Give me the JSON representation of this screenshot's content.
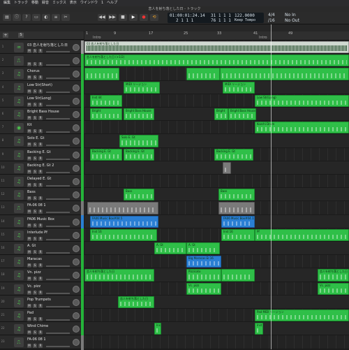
{
  "menubar": {
    "items": [
      "編集",
      "トラック",
      "移動",
      "録音",
      "ミックス",
      "表示",
      "ウインドウ",
      "1",
      "ヘルプ"
    ]
  },
  "window": {
    "title": "恋人を射ち落とした日 - トラック"
  },
  "lcd": {
    "position": "01:00:01:24.14",
    "position_sub": "2  1  1   1",
    "bars": "31  1  1   1",
    "bars_sub": "76  1  1   1",
    "tempo": "122.0000",
    "tempo_mode": "Keep Tempo",
    "signature": "4/4",
    "division": "/16",
    "in": "No In",
    "out": "No Out"
  },
  "ruler": {
    "ticks": [
      "1",
      "9",
      "17",
      "25",
      "33",
      "41",
      "49"
    ],
    "markers": [
      "Intro",
      "Intro"
    ]
  },
  "tracks": [
    {
      "num": "1",
      "name": "03 恋人を射ち落とした日",
      "icon": "audio-icon",
      "color": "#9a9a9a"
    },
    {
      "num": "2",
      "name": "",
      "icon": "midi-icon",
      "color": "#25b43a"
    },
    {
      "num": "3",
      "name": "Chorus",
      "icon": "synth-icon",
      "color": "#25b43a"
    },
    {
      "num": "4",
      "name": "Low Str(Short)",
      "icon": "synth-icon",
      "color": "#25b43a"
    },
    {
      "num": "5",
      "name": "Low Str(Long)",
      "icon": "synth-icon",
      "color": "#25b43a"
    },
    {
      "num": "6",
      "name": "Bright Bass House",
      "icon": "synth-icon",
      "color": "#25b43a"
    },
    {
      "num": "7",
      "name": "Kit",
      "icon": "drum-icon",
      "color": "#25b43a"
    },
    {
      "num": "8",
      "name": "Solo E. Gt",
      "icon": "synth-icon",
      "color": "#25b43a"
    },
    {
      "num": "9",
      "name": "Backing E. Gt",
      "icon": "synth-icon",
      "color": "#25b43a"
    },
    {
      "num": "10",
      "name": "Backing E. Gt 2",
      "icon": "synth-icon",
      "color": "#25b43a"
    },
    {
      "num": "11",
      "name": "Delayed E. Gt",
      "icon": "synth-icon",
      "color": "#25b43a"
    },
    {
      "num": "12",
      "name": "Bass",
      "icon": "synth-icon",
      "color": "#25b43a"
    },
    {
      "num": "13",
      "name": "FA-06 08 1",
      "icon": "midi-icon",
      "color": "#7a7a7a"
    },
    {
      "num": "14",
      "name": "FA06 Music Box",
      "icon": "synth-icon",
      "color": "#2a7fd4"
    },
    {
      "num": "15",
      "name": "Interlude Pf",
      "icon": "synth-icon",
      "color": "#25b43a"
    },
    {
      "num": "16",
      "name": "A. Gt",
      "icon": "synth-icon",
      "color": "#25b43a"
    },
    {
      "num": "17",
      "name": "Maracas",
      "icon": "synth-icon",
      "color": "#25b43a"
    },
    {
      "num": "18",
      "name": "Vn. pizz",
      "icon": "synth-icon",
      "color": "#25b43a"
    },
    {
      "num": "19",
      "name": "Vc. pizz",
      "icon": "synth-icon",
      "color": "#25b43a"
    },
    {
      "num": "20",
      "name": "Pop Trumpets",
      "icon": "synth-icon",
      "color": "#25b43a"
    },
    {
      "num": "21",
      "name": "Pad",
      "icon": "synth-icon",
      "color": "#25b43a"
    },
    {
      "num": "22",
      "name": "Wind Chime",
      "icon": "synth-icon",
      "color": "#25b43a"
    },
    {
      "num": "23",
      "name": "FA-06 08 1",
      "icon": "midi-icon",
      "color": "#7a7a7a"
    }
  ],
  "regions": [
    {
      "track": 0,
      "start": 0,
      "len": 379,
      "label": "03 恋人を射ち落とした日",
      "kind": "white"
    },
    {
      "track": 1,
      "start": 0,
      "len": 379,
      "label": "恋人を射ち落とした日 (+1/2)",
      "kind": "green"
    },
    {
      "track": 2,
      "start": 0,
      "len": 50,
      "label": "",
      "kind": "green"
    },
    {
      "track": 2,
      "start": 146,
      "len": 48,
      "label": "",
      "kind": "green"
    },
    {
      "track": 2,
      "start": 194,
      "len": 185,
      "label": "",
      "kind": "green"
    },
    {
      "track": 3,
      "start": 56,
      "len": 52,
      "label": "MIDI リージョン",
      "kind": "green"
    },
    {
      "track": 3,
      "start": 198,
      "len": 46,
      "label": "MIDI リージョン",
      "kind": "green"
    },
    {
      "track": 4,
      "start": 8,
      "len": 46,
      "label": "Inst 44",
      "kind": "green"
    },
    {
      "track": 4,
      "start": 244,
      "len": 135,
      "label": "Low Str(Long)",
      "kind": "green"
    },
    {
      "track": 5,
      "start": 8,
      "len": 46,
      "label": "Bright",
      "kind": "green"
    },
    {
      "track": 5,
      "start": 56,
      "len": 44,
      "label": "Bright Bass House",
      "kind": "green"
    },
    {
      "track": 5,
      "start": 186,
      "len": 20,
      "label": "Bright",
      "kind": "green"
    },
    {
      "track": 5,
      "start": 206,
      "len": 40,
      "label": "Bright Bass House",
      "kind": "green"
    },
    {
      "track": 6,
      "start": 244,
      "len": 135,
      "label": "Kozchi Drum",
      "kind": "green"
    },
    {
      "track": 7,
      "start": 50,
      "len": 56,
      "label": "Solo E. Gt",
      "kind": "green"
    },
    {
      "track": 8,
      "start": 8,
      "len": 46,
      "label": "Backing E. Gt",
      "kind": "green"
    },
    {
      "track": 8,
      "start": 56,
      "len": 44,
      "label": "Backing E. Gt",
      "kind": "green"
    },
    {
      "track": 8,
      "start": 186,
      "len": 56,
      "label": "Backing E. Gt",
      "kind": "green"
    },
    {
      "track": 9,
      "start": 198,
      "len": 12,
      "label": "",
      "kind": "gray"
    },
    {
      "track": 11,
      "start": 56,
      "len": 44,
      "label": "Bass",
      "kind": "green"
    },
    {
      "track": 11,
      "start": 192,
      "len": 52,
      "label": "Bass",
      "kind": "green"
    },
    {
      "track": 12,
      "start": 4,
      "len": 102,
      "label": "",
      "kind": "gray"
    },
    {
      "track": 12,
      "start": 192,
      "len": 52,
      "label": "",
      "kind": "gray"
    },
    {
      "track": 13,
      "start": 8,
      "len": 98,
      "label": "FA06 Music Box#04.5",
      "kind": "blue"
    },
    {
      "track": 13,
      "start": 196,
      "len": 48,
      "label": "FA06 Music Box#04.12",
      "kind": "blue"
    },
    {
      "track": 14,
      "start": 8,
      "len": 96,
      "label": "Inst 16",
      "kind": "green"
    },
    {
      "track": 14,
      "start": 196,
      "len": 48,
      "label": "Inst 16",
      "kind": "green"
    },
    {
      "track": 14,
      "start": 244,
      "len": 135,
      "label": "Pf",
      "kind": "green"
    },
    {
      "track": 15,
      "start": 100,
      "len": 46,
      "label": "A. Gt",
      "kind": "green"
    },
    {
      "track": 15,
      "start": 146,
      "len": 48,
      "label": "A. Gt",
      "kind": "green"
    },
    {
      "track": 16,
      "start": 146,
      "len": 50,
      "label": "Big Maracas Er.16",
      "kind": "blue"
    },
    {
      "track": 17,
      "start": 0,
      "len": 100,
      "label": "恋人を射ち落とした日",
      "kind": "green"
    },
    {
      "track": 17,
      "start": 146,
      "len": 50,
      "label": "Pizzicato",
      "kind": "green"
    },
    {
      "track": 17,
      "start": 196,
      "len": 48,
      "label": "",
      "kind": "green"
    },
    {
      "track": 17,
      "start": 334,
      "len": 45,
      "label": "恋人を射ち落とした日",
      "kind": "green"
    },
    {
      "track": 18,
      "start": 146,
      "len": 50,
      "label": "Vc. pizz",
      "kind": "green"
    },
    {
      "track": 18,
      "start": 334,
      "len": 45,
      "label": "Vc. pizz",
      "kind": "green"
    },
    {
      "track": 19,
      "start": 48,
      "len": 52,
      "label": "恋人を射ち落とした日",
      "kind": "green"
    },
    {
      "track": 20,
      "start": 244,
      "len": 135,
      "label": "Pad           MIDI リージョン",
      "kind": "green"
    },
    {
      "track": 21,
      "start": 100,
      "len": 10,
      "label": "Inst",
      "kind": "green"
    },
    {
      "track": 21,
      "start": 244,
      "len": 12,
      "label": "Inst 16",
      "kind": "green"
    }
  ]
}
